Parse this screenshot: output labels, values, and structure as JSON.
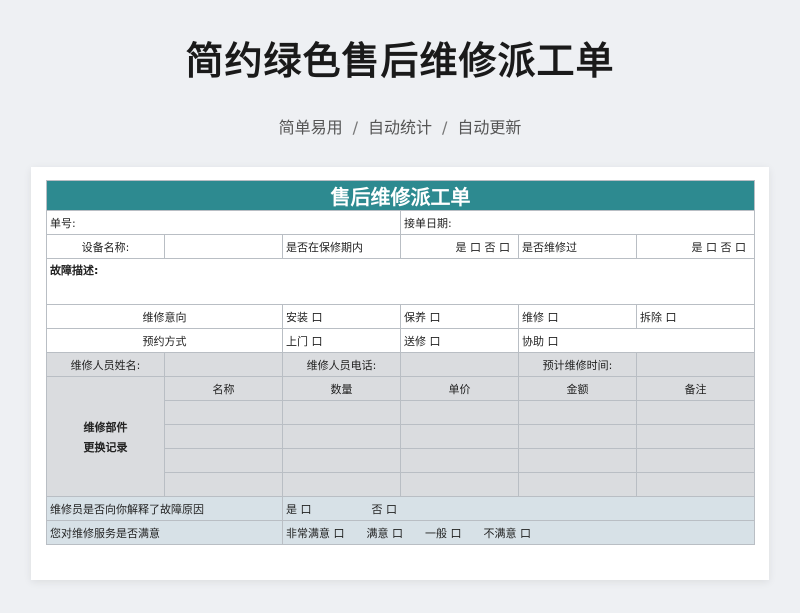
{
  "page": {
    "title": "简约绿色售后维修派工单",
    "subtitle_items": [
      "简单易用",
      "自动统计",
      "自动更新"
    ],
    "subtitle_sep": "/"
  },
  "form": {
    "header": "售后维修派工单",
    "order_no_label": "单号:",
    "order_date_label": "接单日期:",
    "device_name_label": "设备名称:",
    "warranty_label": "是否在保修期内",
    "warranty_options": "是 口  否 口",
    "repaired_label": "是否维修过",
    "repaired_options": "是 口  否 口",
    "fault_desc_label": "故障描述:",
    "intent_label": "维修意向",
    "intent_options": [
      "安装 口",
      "保养 口",
      "维修 口",
      "拆除 口"
    ],
    "booking_label": "预约方式",
    "booking_options": [
      "上门 口",
      "送修 口",
      "协助 口"
    ],
    "tech_name_label": "维修人员姓名:",
    "tech_phone_label": "维修人员电话:",
    "est_time_label": "预计维修时间:",
    "parts_label_line1": "维修部件",
    "parts_label_line2": "更换记录",
    "parts_columns": [
      "名称",
      "数量",
      "单价",
      "金额",
      "备注"
    ],
    "explained_question": "维修员是否向你解释了故障原因",
    "explained_options": [
      "是 口",
      "否 口"
    ],
    "satisfaction_question": "您对维修服务是否满意",
    "satisfaction_options": [
      "非常满意 口",
      "满意 口",
      "一般 口",
      "不满意 口"
    ]
  }
}
